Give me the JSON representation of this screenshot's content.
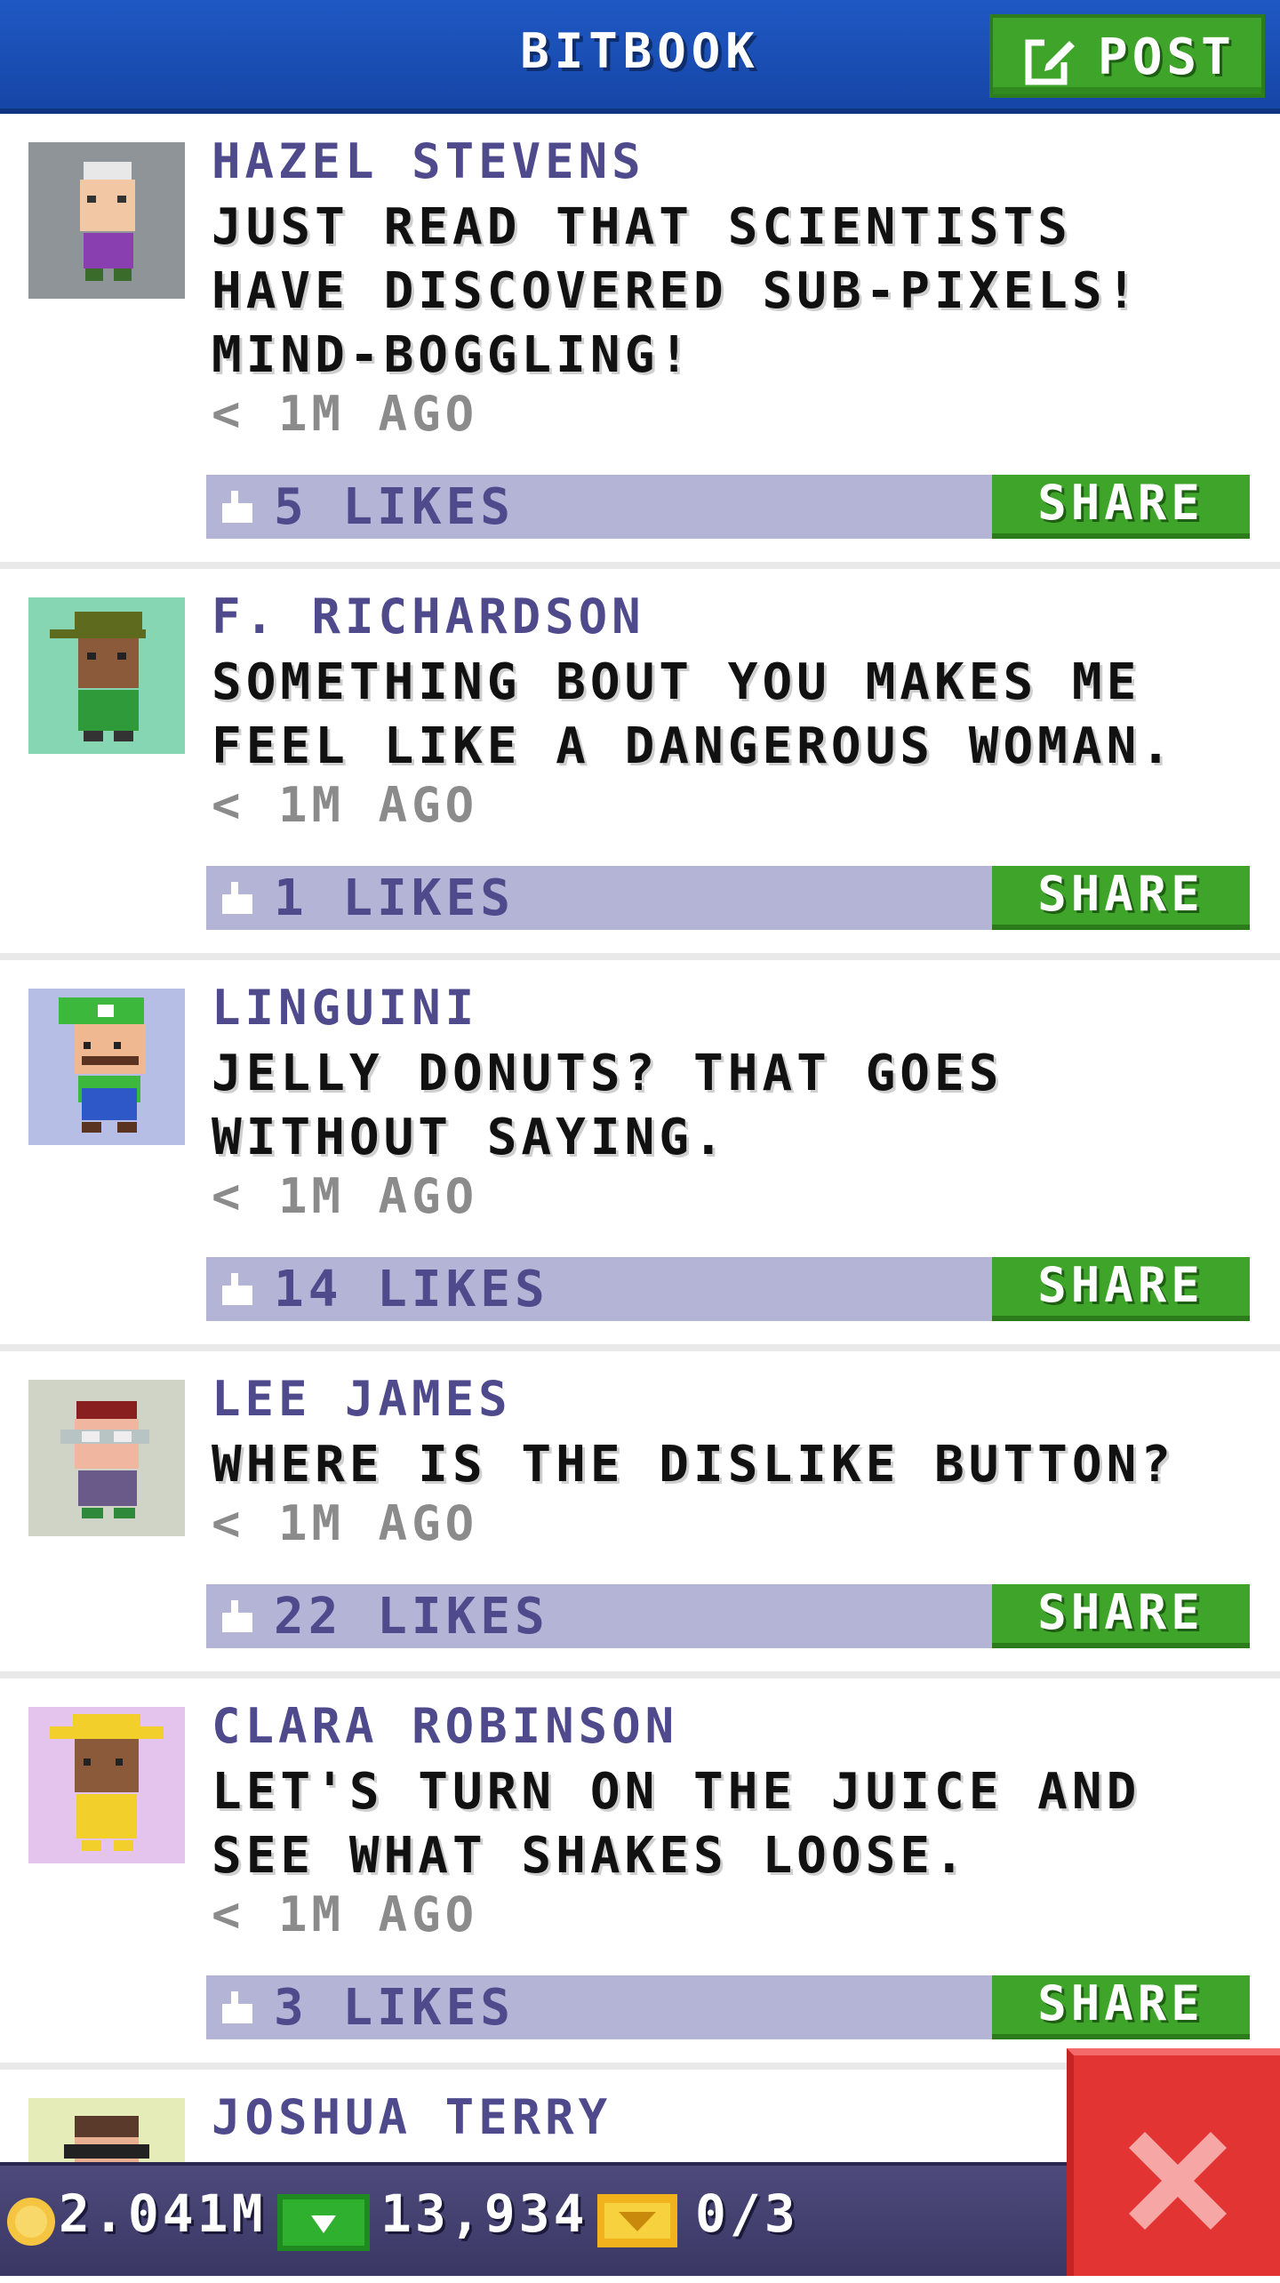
{
  "header": {
    "title": "BITBOOK",
    "post_label": "POST"
  },
  "posts": [
    {
      "author": "HAZEL STEVENS",
      "message": "JUST READ THAT SCIENTISTS HAVE DISCOVERED SUB-PIXELS! MIND-BOGGLING!",
      "time": "< 1M AGO",
      "likes": "5 LIKES",
      "share_label": "SHARE",
      "avatar_bg": "#8f9499"
    },
    {
      "author": "F. RICHARDSON",
      "message": "SOMETHING BOUT YOU MAKES ME FEEL LIKE A DANGEROUS WOMAN.",
      "time": "< 1M AGO",
      "likes": "1 LIKES",
      "share_label": "SHARE",
      "avatar_bg": "#86d6b4"
    },
    {
      "author": "LINGUINI",
      "message": "JELLY DONUTS? THAT GOES WITHOUT SAYING.",
      "time": "< 1M AGO",
      "likes": "14 LIKES",
      "share_label": "SHARE",
      "avatar_bg": "#b6bee6"
    },
    {
      "author": "LEE JAMES",
      "message": "WHERE IS THE DISLIKE BUTTON?",
      "time": "< 1M AGO",
      "likes": "22 LIKES",
      "share_label": "SHARE",
      "avatar_bg": "#cfd4c6"
    },
    {
      "author": "CLARA ROBINSON",
      "message": "LET'S TURN ON THE JUICE AND SEE WHAT SHAKES LOOSE.",
      "time": "< 1M AGO",
      "likes": "3 LIKES",
      "share_label": "SHARE",
      "avatar_bg": "#e4c4ec"
    },
    {
      "author": "JOSHUA TERRY",
      "avatar_bg": "#e6ecb8"
    }
  ],
  "status": {
    "coins": "2.041M",
    "bux": "13,934",
    "tickets": "0/3"
  },
  "colors": {
    "header_blue": "#1f58c4",
    "green_button": "#3fa42a",
    "likes_bar": "#b3b4d6",
    "author_purple": "#4f4a8c",
    "close_red": "#e33434"
  },
  "icons": {
    "post": "edit-icon",
    "like": "thumbs-up-icon",
    "coin": "coin-icon",
    "bux": "bux-icon",
    "ticket": "ticket-icon",
    "close": "close-icon"
  }
}
